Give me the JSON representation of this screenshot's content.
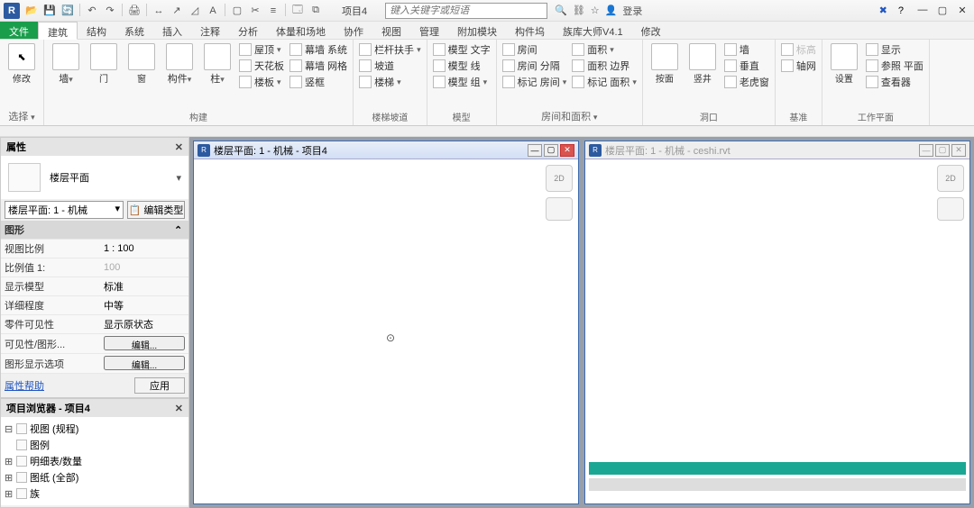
{
  "titlebar": {
    "logo": "R",
    "project": "项目4",
    "search_placeholder": "键入关键字或短语",
    "login": "登录"
  },
  "qat_icons": [
    "open",
    "save",
    "sync",
    "undo",
    "redo",
    "print",
    "measure",
    "line",
    "angle",
    "text",
    "box",
    "crop",
    "expr",
    "edit",
    "panel"
  ],
  "menu": {
    "file": "文件",
    "tabs": [
      "建筑",
      "结构",
      "系统",
      "插入",
      "注释",
      "分析",
      "体量和场地",
      "协作",
      "视图",
      "管理",
      "附加模块",
      "构件坞",
      "族库大师V4.1",
      "修改"
    ],
    "active": 0
  },
  "ribbon": {
    "g1": {
      "label": "选择",
      "btn": "修改"
    },
    "g2": {
      "label": "构建",
      "items": [
        "墙",
        "门",
        "窗",
        "构件",
        "柱"
      ],
      "rows": [
        [
          "屋顶",
          "幕墙 系统"
        ],
        [
          "天花板",
          "幕墙 网格"
        ],
        [
          "楼板",
          "竖框"
        ]
      ]
    },
    "g3": {
      "label": "楼梯坡道",
      "rows": [
        [
          "栏杆扶手"
        ],
        [
          "坡道"
        ],
        [
          "楼梯"
        ]
      ]
    },
    "g4": {
      "label": "模型",
      "rows": [
        [
          "模型 文字"
        ],
        [
          "模型 线"
        ],
        [
          "模型 组"
        ]
      ]
    },
    "g5": {
      "label": "房间和面积",
      "rows": [
        [
          "房间",
          "面积"
        ],
        [
          "房间 分隔",
          "面积 边界"
        ],
        [
          "标记 房间",
          "标记 面积"
        ]
      ]
    },
    "g6": {
      "label": "洞口",
      "rows": [
        [
          "按面",
          "竖井",
          "墙"
        ],
        [
          "",
          "",
          "垂直"
        ],
        [
          "",
          "",
          "老虎窗"
        ]
      ]
    },
    "g7": {
      "label": "基准",
      "rows": [
        [
          "标高"
        ],
        [
          "轴网"
        ]
      ]
    },
    "g8": {
      "label": "工作平面",
      "rows": [
        [
          "设置",
          "显示"
        ],
        [
          "",
          "参照 平面"
        ],
        [
          "",
          "查看器"
        ]
      ]
    }
  },
  "prop": {
    "title": "属性",
    "type": "楼层平面",
    "instance": "楼层平面: 1 - 机械",
    "edit_type": "编辑类型",
    "cat": "图形",
    "rows": [
      {
        "k": "视图比例",
        "v": "1 : 100"
      },
      {
        "k": "比例值 1:",
        "v": "100",
        "dim": true
      },
      {
        "k": "显示模型",
        "v": "标准"
      },
      {
        "k": "详细程度",
        "v": "中等"
      },
      {
        "k": "零件可见性",
        "v": "显示原状态"
      },
      {
        "k": "可见性/图形...",
        "v": "编辑...",
        "btn": true
      },
      {
        "k": "图形显示选项",
        "v": "编辑...",
        "btn": true
      }
    ],
    "help": "属性帮助",
    "apply": "应用"
  },
  "browser": {
    "title": "项目浏览器 - 项目4",
    "nodes": [
      {
        "tg": "⊟",
        "label": "视图 (规程)"
      },
      {
        "tg": "",
        "label": "图例"
      },
      {
        "tg": "⊞",
        "label": "明细表/数量"
      },
      {
        "tg": "⊞",
        "label": "图纸 (全部)"
      },
      {
        "tg": "⊞",
        "label": "族"
      }
    ]
  },
  "views": {
    "left": {
      "title": "楼层平面: 1 - 机械 - 项目4"
    },
    "right": {
      "title": "楼层平面: 1 - 机械 - ceshi.rvt"
    }
  }
}
